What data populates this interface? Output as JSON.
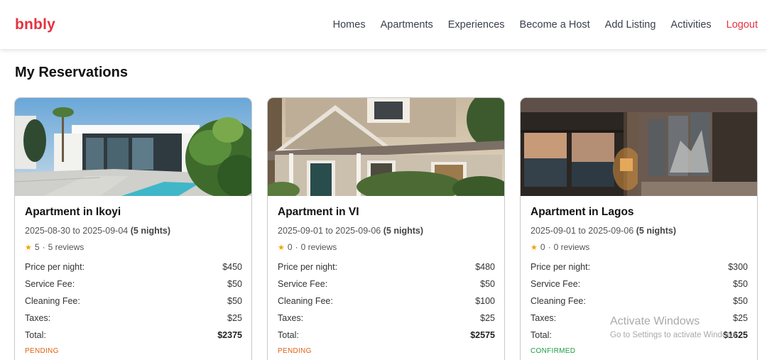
{
  "brand": "bnbly",
  "nav": {
    "links": [
      "Homes",
      "Apartments",
      "Experiences",
      "Become a Host",
      "Add Listing",
      "Activities"
    ],
    "logout": "Logout"
  },
  "page_title": "My Reservations",
  "reservations": [
    {
      "title": "Apartment in Ikoyi",
      "dates": "2025-08-30 to 2025-09-04",
      "nights": "(5 nights)",
      "rating": "5",
      "reviews": "5 reviews",
      "labels": [
        "Price per night:",
        "Service Fee:",
        "Cleaning Fee:",
        "Taxes:",
        "Total:"
      ],
      "price_per_night": "$450",
      "service_fee": "$50",
      "cleaning_fee": "$50",
      "taxes": "$25",
      "total": "$2375",
      "status": "PENDING"
    },
    {
      "title": "Apartment in VI",
      "dates": "2025-09-01 to 2025-09-06",
      "nights": "(5 nights)",
      "rating": "0",
      "reviews": "0 reviews",
      "labels": [
        "Price per night:",
        "Service Fee:",
        "Cleaning Fee:",
        "Taxes:",
        "Total:"
      ],
      "price_per_night": "$480",
      "service_fee": "$50",
      "cleaning_fee": "$100",
      "taxes": "$25",
      "total": "$2575",
      "status": "PENDING"
    },
    {
      "title": "Apartment in Lagos",
      "dates": "2025-09-01 to 2025-09-06",
      "nights": "(5 nights)",
      "rating": "0",
      "reviews": "0 reviews",
      "labels": [
        "Price per night:",
        "Service Fee:",
        "Cleaning Fee:",
        "Taxes:",
        "Total:"
      ],
      "price_per_night": "$300",
      "service_fee": "$50",
      "cleaning_fee": "$50",
      "taxes": "$25",
      "total": "$1625",
      "status": "CONFIRMED"
    }
  ],
  "separator": "·",
  "watermark": {
    "title": "Activate Windows",
    "subtitle": "Go to Settings to activate Windows."
  },
  "colors": {
    "brand": "#e5323f",
    "pending": "#e06010",
    "confirmed": "#1f9a44",
    "star": "#f0a500"
  }
}
